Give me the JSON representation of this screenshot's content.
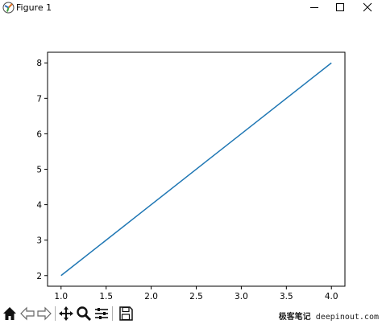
{
  "window": {
    "title": "Figure 1",
    "controls": [
      "minimize",
      "maximize",
      "close"
    ]
  },
  "toolbar": {
    "buttons": [
      {
        "name": "home",
        "icon": "home-icon"
      },
      {
        "name": "back",
        "icon": "arrow-left-icon"
      },
      {
        "name": "forward",
        "icon": "arrow-right-icon"
      },
      {
        "name": "pan",
        "icon": "move-icon"
      },
      {
        "name": "zoom",
        "icon": "magnifier-icon"
      },
      {
        "name": "subplots",
        "icon": "sliders-icon"
      },
      {
        "name": "save",
        "icon": "floppy-disk-icon"
      }
    ]
  },
  "watermark": {
    "cn": "极客笔记",
    "site": "deepinout.com"
  },
  "chart_data": {
    "type": "line",
    "x": [
      1.0,
      2.0,
      3.0,
      4.0
    ],
    "series": [
      {
        "values": [
          2,
          4,
          6,
          8
        ],
        "color": "#1f77b4"
      }
    ],
    "xlim": [
      0.85,
      4.15
    ],
    "ylim": [
      1.7,
      8.3
    ],
    "xticks": [
      "1.0",
      "1.5",
      "2.0",
      "2.5",
      "3.0",
      "3.5",
      "4.0"
    ],
    "xtick_values": [
      1.0,
      1.5,
      2.0,
      2.5,
      3.0,
      3.5,
      4.0
    ],
    "yticks": [
      "2",
      "3",
      "4",
      "5",
      "6",
      "7",
      "8"
    ],
    "ytick_values": [
      2,
      3,
      4,
      5,
      6,
      7,
      8
    ],
    "grid": false,
    "legend": "none"
  }
}
